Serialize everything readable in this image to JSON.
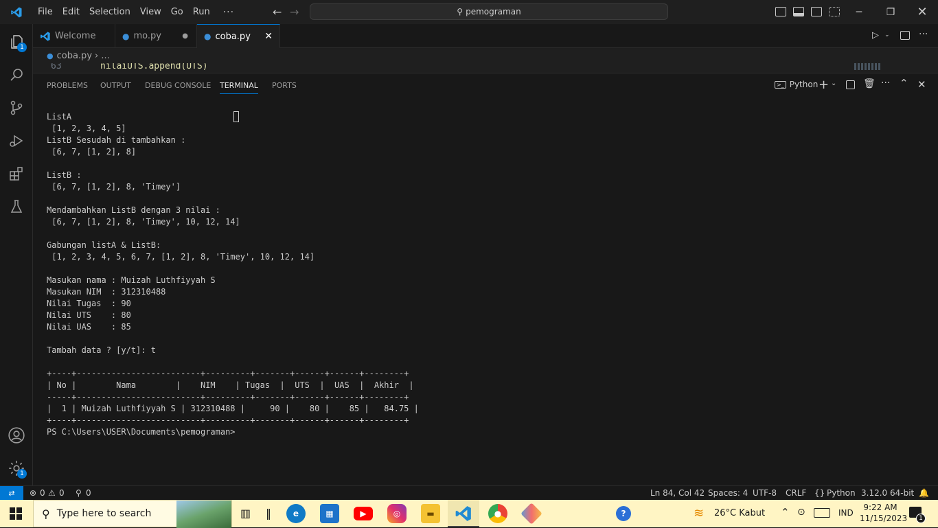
{
  "titlebar": {
    "menu": [
      "File",
      "Edit",
      "Selection",
      "View",
      "Go",
      "Run"
    ],
    "more": "···",
    "search": "pemograman"
  },
  "activity": {
    "explorer_badge": "1",
    "manage_badge": "1"
  },
  "tabs": [
    {
      "label": "Welcome"
    },
    {
      "label": "mo.py"
    },
    {
      "label": "coba.py"
    }
  ],
  "breadcrumb": {
    "file": "coba.py",
    "rest": "›  ..."
  },
  "editor": {
    "line_number": "63",
    "code": "nilaiUTS.append(UTS)"
  },
  "panel": {
    "tabs": [
      "PROBLEMS",
      "OUTPUT",
      "DEBUG CONSOLE",
      "TERMINAL",
      "PORTS"
    ],
    "shell": "Python"
  },
  "terminal": {
    "lines": [
      "ListA",
      " [1, 2, 3, 4, 5]",
      "ListB Sesudah di tambahkan :",
      " [6, 7, [1, 2], 8]",
      "",
      "ListB :",
      " [6, 7, [1, 2], 8, 'Timey']",
      "",
      "Mendambahkan ListB dengan 3 nilai :",
      " [6, 7, [1, 2], 8, 'Timey', 10, 12, 14]",
      "",
      "Gabungan listA & ListB:",
      " [1, 2, 3, 4, 5, 6, 7, [1, 2], 8, 'Timey', 10, 12, 14]",
      "",
      "Masukan nama : Muizah Luthfiyyah S",
      "Masukan NIM  : 312310488",
      "Nilai Tugas  : 90",
      "Nilai UTS    : 80",
      "Nilai UAS    : 85",
      "",
      "Tambah data ? [y/t]: t",
      "",
      "+----+-------------------------+---------+-------+------+------+--------+",
      "| No |        Nama        |    NIM    | Tugas  |  UTS  |  UAS  |  Akhir  |",
      "-----+-------------------------+---------+-------+------+------+--------+",
      "|  1 | Muizah Luthfiyyah S | 312310488 |     90 |    80 |    85 |   84.75 |",
      "+----+-------------------------+---------+-------+------+------+--------+",
      "PS C:\\Users\\USER\\Documents\\pemograman>"
    ]
  },
  "statusbar": {
    "errors": "0",
    "warnings": "0",
    "ports": "0",
    "position": "Ln 84, Col 42",
    "spaces": "Spaces: 4",
    "encoding": "UTF-8",
    "eol": "CRLF",
    "language": "Python",
    "interpreter": "3.12.0 64-bit"
  },
  "taskbar": {
    "search_placeholder": "Type here to search",
    "weather": "26°C  Kabut",
    "language": "IND",
    "time": "9:22 AM",
    "date": "11/15/2023",
    "notifications": "1"
  }
}
